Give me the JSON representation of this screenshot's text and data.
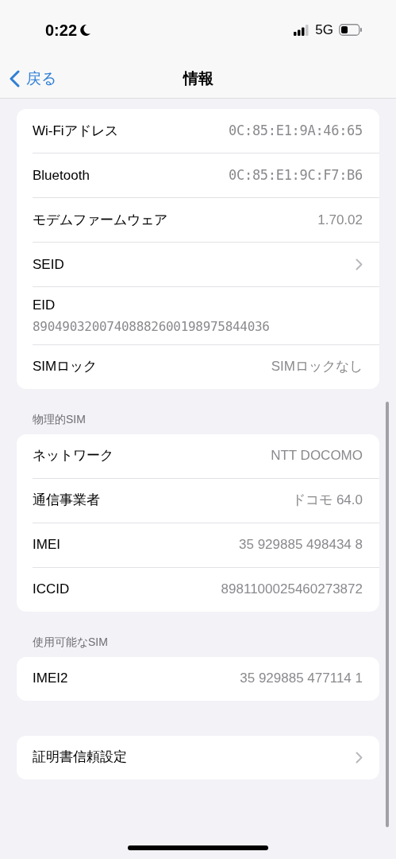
{
  "status_bar": {
    "time": "0:22",
    "network": "5G"
  },
  "nav": {
    "back": "戻る",
    "title": "情報"
  },
  "sections": [
    {
      "rows": [
        {
          "kind": "mono",
          "label": "Wi-Fiアドレス",
          "value": "0C:85:E1:9A:46:65"
        },
        {
          "kind": "mono",
          "label": "Bluetooth",
          "value": "0C:85:E1:9C:F7:B6"
        },
        {
          "kind": "value",
          "label": "モデムファームウェア",
          "value": "1.70.02"
        },
        {
          "kind": "chevron",
          "label": "SEID"
        },
        {
          "kind": "stacked",
          "label": "EID",
          "value": "89049032007408882600198975844036"
        },
        {
          "kind": "value",
          "label": "SIMロック",
          "value": "SIMロックなし"
        }
      ]
    },
    {
      "header": "物理的SIM",
      "rows": [
        {
          "kind": "value",
          "label": "ネットワーク",
          "value": "NTT DOCOMO"
        },
        {
          "kind": "value",
          "label": "通信事業者",
          "value": "ドコモ 64.0"
        },
        {
          "kind": "value",
          "label": "IMEI",
          "value": "35 929885 498434 8"
        },
        {
          "kind": "value",
          "label": "ICCID",
          "value": "8981100025460273872"
        }
      ]
    },
    {
      "header": "使用可能なSIM",
      "rows": [
        {
          "kind": "value",
          "label": "IMEI2",
          "value": "35 929885 477114 1"
        }
      ]
    },
    {
      "rows": [
        {
          "kind": "chevron",
          "label": "証明書信頼設定"
        }
      ]
    }
  ]
}
